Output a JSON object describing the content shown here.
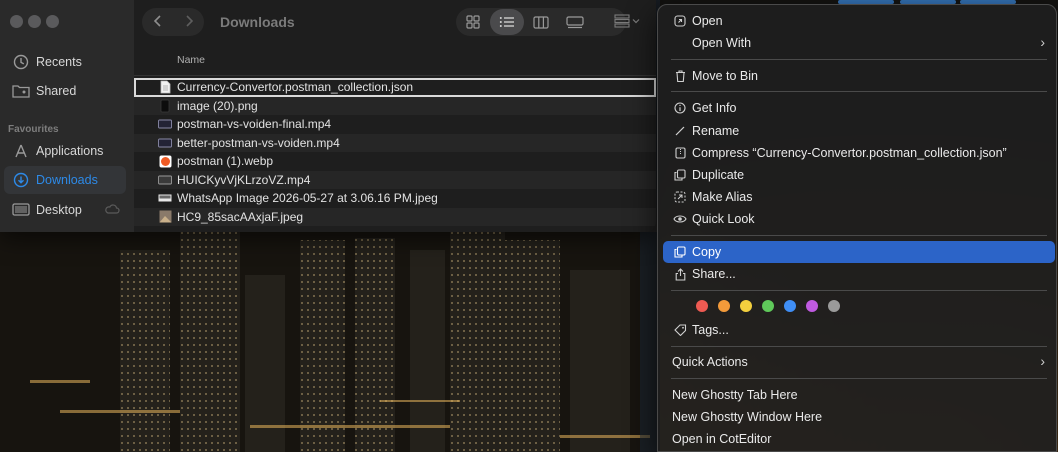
{
  "window": {
    "title": "Downloads",
    "traffic_lights": [
      "close",
      "minimize",
      "zoom"
    ]
  },
  "toolbar": {
    "back_icon": "chevron-left-icon",
    "forward_icon": "chevron-right-icon",
    "views": [
      "icon-view",
      "list-view",
      "column-view",
      "gallery-view"
    ],
    "active_view": "list-view"
  },
  "sidebar": {
    "items": [
      {
        "label": "Recents",
        "icon": "clock-icon"
      },
      {
        "label": "Shared",
        "icon": "shared-folder-icon"
      }
    ],
    "section_label": "Favourites",
    "favourites": [
      {
        "label": "Applications",
        "icon": "applications-icon"
      },
      {
        "label": "Downloads",
        "icon": "downloads-icon",
        "selected": true
      },
      {
        "label": "Desktop",
        "icon": "desktop-icon"
      }
    ]
  },
  "list": {
    "column_header": "Name",
    "files": [
      {
        "name": "Currency-Convertor.postman_collection.json",
        "icon": "document-icon",
        "selected": true
      },
      {
        "name": "image (20).png",
        "icon": "image-icon"
      },
      {
        "name": "postman-vs-voiden-final.mp4",
        "icon": "video-icon"
      },
      {
        "name": "better-postman-vs-voiden.mp4",
        "icon": "video-icon"
      },
      {
        "name": "postman (1).webp",
        "icon": "postman-image-icon"
      },
      {
        "name": "HUICKyvVjKLrzoVZ.mp4",
        "icon": "video-icon"
      },
      {
        "name": "WhatsApp Image 2026-05-27 at 3.06.16 PM.jpeg",
        "icon": "image-icon"
      },
      {
        "name": "HC9_85sacAAxjaF.jpeg",
        "icon": "image-icon"
      }
    ]
  },
  "context_menu": {
    "open": "Open",
    "open_with": "Open With",
    "move_to_bin": "Move to Bin",
    "get_info": "Get Info",
    "rename": "Rename",
    "compress": "Compress “Currency-Convertor.postman_collection.json”",
    "duplicate": "Duplicate",
    "make_alias": "Make Alias",
    "quick_look": "Quick Look",
    "copy": "Copy",
    "share": "Share...",
    "tags": "Tags...",
    "quick_actions": "Quick Actions",
    "services": [
      "New Ghostty Tab Here",
      "New Ghostty Window Here",
      "Open in CotEditor"
    ],
    "highlighted_item": "Copy",
    "highlight_color": "#2c64c8",
    "tag_colors": [
      "#ee5a52",
      "#f39a3a",
      "#f3cf3e",
      "#5fc95a",
      "#3f8ef5",
      "#bf5ae0",
      "#9a9a9a"
    ]
  }
}
